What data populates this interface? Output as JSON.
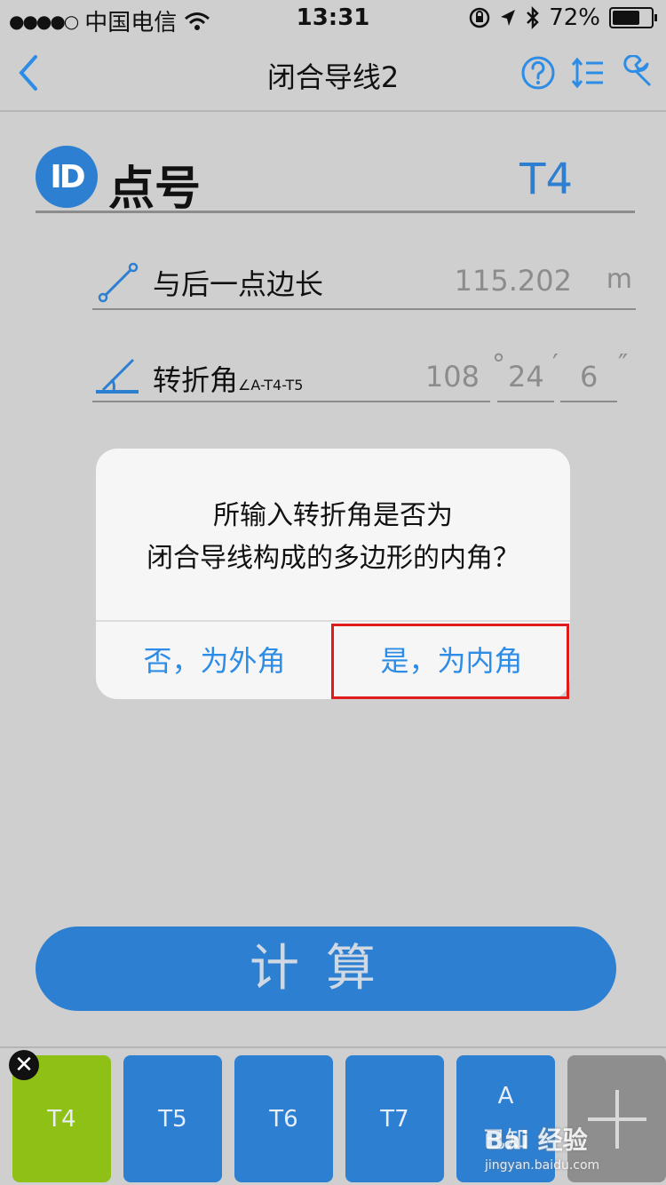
{
  "status_bar": {
    "signal": "●●●●○",
    "carrier": "中国电信",
    "time": "13:31",
    "battery_percent": "72%",
    "battery_level": 0.72
  },
  "nav": {
    "title": "闭合导线2",
    "icons": [
      "back-icon",
      "help-icon",
      "sort-icon",
      "wrench-icon"
    ]
  },
  "point": {
    "badge": "ID",
    "label": "点号",
    "value": "T4"
  },
  "edge": {
    "label": "与后一点边长",
    "value": "115.202",
    "unit": "m"
  },
  "angle": {
    "label": "转折角",
    "label_sub": "∠A-T4-T5",
    "degrees": "108",
    "degree_sym": "°",
    "minutes": "24",
    "minute_sym": "′",
    "seconds": "6",
    "second_sym": "″"
  },
  "dialog": {
    "line1": "所输入转折角是否为",
    "line2": "闭合导线构成的多边形的内角？",
    "no_label": "否，为外角",
    "yes_label": "是，为内角"
  },
  "calc_label": "计算",
  "tabs": [
    {
      "label": "T4",
      "state": "active"
    },
    {
      "label": "T5",
      "state": "normal"
    },
    {
      "label": "T6",
      "state": "normal"
    },
    {
      "label": "T7",
      "state": "normal"
    },
    {
      "label": "A",
      "sub": "已知",
      "state": "normal"
    }
  ],
  "tab_close": "✕",
  "watermark": {
    "brand": "Bai 经验",
    "url": "jingyan.baidu.com"
  },
  "colors": {
    "accent": "#2d7fd2",
    "active_tab": "#8fc016",
    "highlight": "#e01b1b"
  }
}
